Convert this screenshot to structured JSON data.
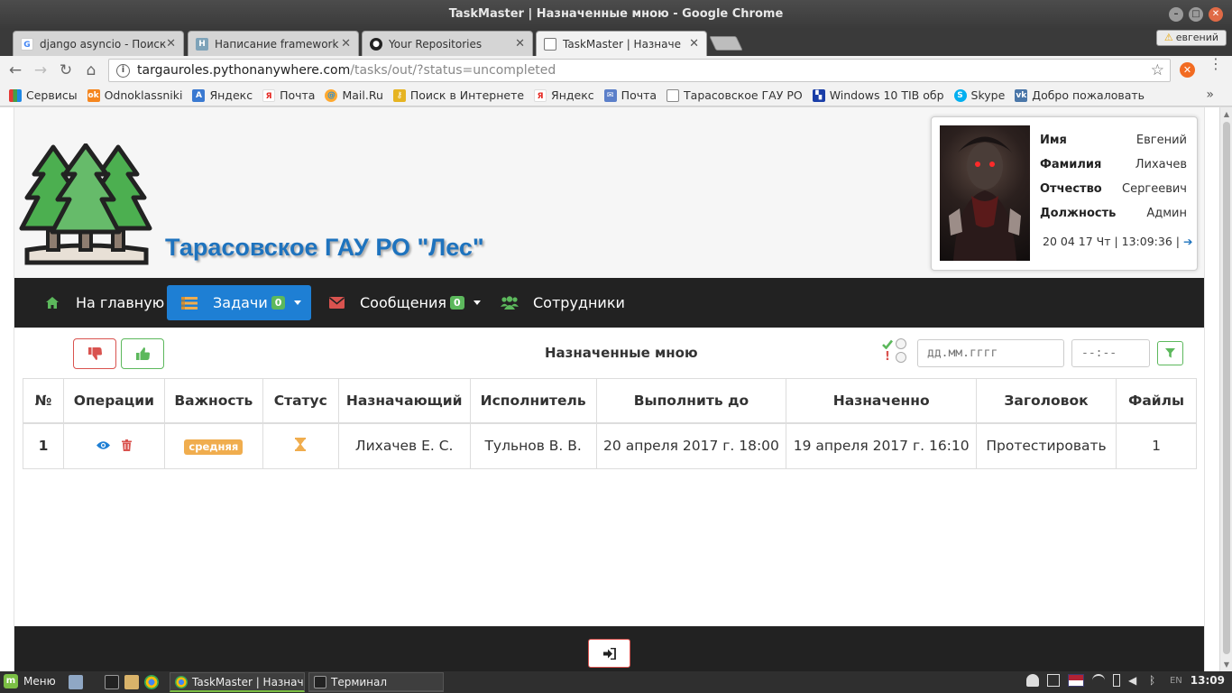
{
  "window": {
    "title": "TaskMaster | Назначенные мною - Google Chrome"
  },
  "browser": {
    "tabs": [
      {
        "label": "django asyncio - Поиск",
        "icon": "google-icon",
        "active": false
      },
      {
        "label": "Написание framework",
        "icon": "habr-icon",
        "active": false
      },
      {
        "label": "Your Repositories",
        "icon": "github-icon",
        "active": false
      },
      {
        "label": "TaskMaster | Назначе",
        "icon": "page-icon",
        "active": true
      }
    ],
    "profile_name": "евгений",
    "url_host": "targauroles.pythonanywhere.com",
    "url_path": "/tasks/out/?status=uncompleted",
    "bookmarks": [
      {
        "label": "Сервисы",
        "icon": "apps-grid-icon"
      },
      {
        "label": "Odnoklassniki",
        "icon": "ok-icon"
      },
      {
        "label": "Яндекс",
        "icon": "yandex-translate-icon"
      },
      {
        "label": "Почта",
        "icon": "yandex-icon"
      },
      {
        "label": "Mail.Ru",
        "icon": "mailru-icon"
      },
      {
        "label": "Поиск в Интернете",
        "icon": "search-key-icon"
      },
      {
        "label": "Яндекс",
        "icon": "yandex-icon"
      },
      {
        "label": "Почта",
        "icon": "mail-envelope-icon"
      },
      {
        "label": "Тарасовское ГАУ РО",
        "icon": "page-icon"
      },
      {
        "label": "Windows 10 TIB обр",
        "icon": "windows-icon"
      },
      {
        "label": "Skype",
        "icon": "skype-icon"
      },
      {
        "label": "Добро пожаловать",
        "icon": "vk-icon"
      }
    ]
  },
  "site": {
    "org_title": "Тарасовское ГАУ РО \"Лес\"",
    "profile": {
      "rows": [
        {
          "key": "Имя",
          "value": "Евгений"
        },
        {
          "key": "Фамилия",
          "value": "Лихачев"
        },
        {
          "key": "Отчество",
          "value": "Сергеевич"
        },
        {
          "key": "Должность",
          "value": "Админ"
        }
      ],
      "datetime": "20 04 17 Чт | 13:09:36 |"
    },
    "nav": {
      "home": "На главную",
      "tasks": "Задачи",
      "tasks_count": "0",
      "messages": "Сообщения",
      "messages_count": "0",
      "employees": "Сотрудники"
    },
    "list_title": "Назначенные мною",
    "filter": {
      "date_placeholder": "дд.мм.гггг",
      "time_placeholder": "--:--"
    },
    "table": {
      "headers": [
        "№",
        "Операции",
        "Важность",
        "Статус",
        "Назначающий",
        "Исполнитель",
        "Выполнить до",
        "Назначенно",
        "Заголовок",
        "Файлы"
      ],
      "rows": [
        {
          "num": "1",
          "importance": "средняя",
          "status_icon": "hourglass-icon",
          "assigner": "Лихачев Е. С.",
          "executor": "Тульнов В. В.",
          "due": "20 апреля 2017 г. 18:00",
          "assigned": "19 апреля 2017 г. 16:10",
          "title": "Протестировать",
          "files": "1"
        }
      ]
    }
  },
  "taskbar": {
    "menu_label": "Меню",
    "windows": [
      {
        "label": "TaskMaster | Назначе...",
        "icon": "chrome-icon"
      },
      {
        "label": "Терминал",
        "icon": "terminal-icon"
      }
    ],
    "keyboard_layout": "EN",
    "clock": "13:09"
  },
  "colors": {
    "brand_blue": "#1e73be",
    "navbar_bg": "#222222",
    "nav_active": "#1e7fd4",
    "success": "#5cb85c",
    "danger": "#d9534f",
    "warning": "#f0ad4e"
  }
}
